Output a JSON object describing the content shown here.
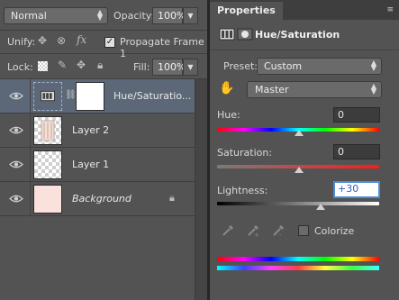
{
  "layers_panel": {
    "blend_mode": "Normal",
    "opacity_label": "Opacity:",
    "opacity_value": "100%",
    "unify_label": "Unify:",
    "propagate_label": "Propagate Frame 1",
    "propagate_checked": true,
    "lock_label": "Lock:",
    "fill_label": "Fill:",
    "fill_value": "100%",
    "layers": [
      {
        "name": "Hue/Saturatio...",
        "type": "adjustment",
        "selected": true
      },
      {
        "name": "Layer 2",
        "type": "pixel",
        "selected": false
      },
      {
        "name": "Layer 1",
        "type": "empty",
        "selected": false
      },
      {
        "name": "Background",
        "type": "background",
        "locked": true,
        "selected": false
      }
    ]
  },
  "properties_panel": {
    "tab_label": "Properties",
    "title": "Hue/Saturation",
    "preset_label": "Preset:",
    "preset_value": "Custom",
    "channel_value": "Master",
    "hue_label": "Hue:",
    "hue_value": "0",
    "saturation_label": "Saturation:",
    "saturation_value": "0",
    "lightness_label": "Lightness:",
    "lightness_value": "+30",
    "colorize_label": "Colorize",
    "colorize_checked": false,
    "colors": {
      "panel": "#535353",
      "selected_layer": "#5c6878",
      "focus_border": "#4a8cd8"
    }
  }
}
